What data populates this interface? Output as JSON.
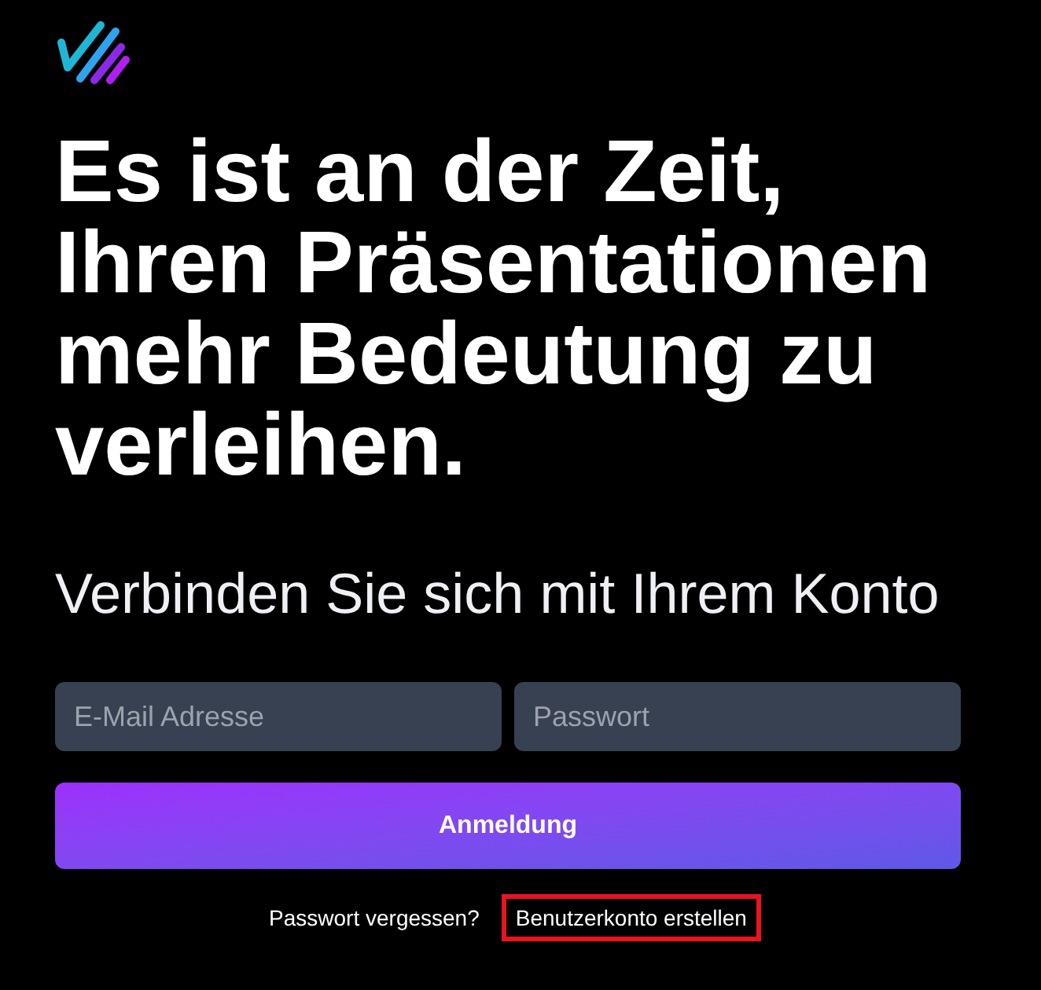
{
  "headline": "Es ist an der Zeit, Ihren Präsentationen mehr Bedeutung zu verleihen.",
  "subtitle": "Verbinden Sie sich mit Ihrem Konto",
  "form": {
    "fields": [
      {
        "placeholder": "E-Mail Adresse"
      },
      {
        "placeholder": "Passwort"
      }
    ],
    "submit": {
      "label": "Anmeldung"
    }
  },
  "links": [
    {
      "label": "Passwort vergessen?",
      "highlighted": false
    },
    {
      "label": "Benutzerkonto erstellen",
      "highlighted": true
    }
  ]
}
